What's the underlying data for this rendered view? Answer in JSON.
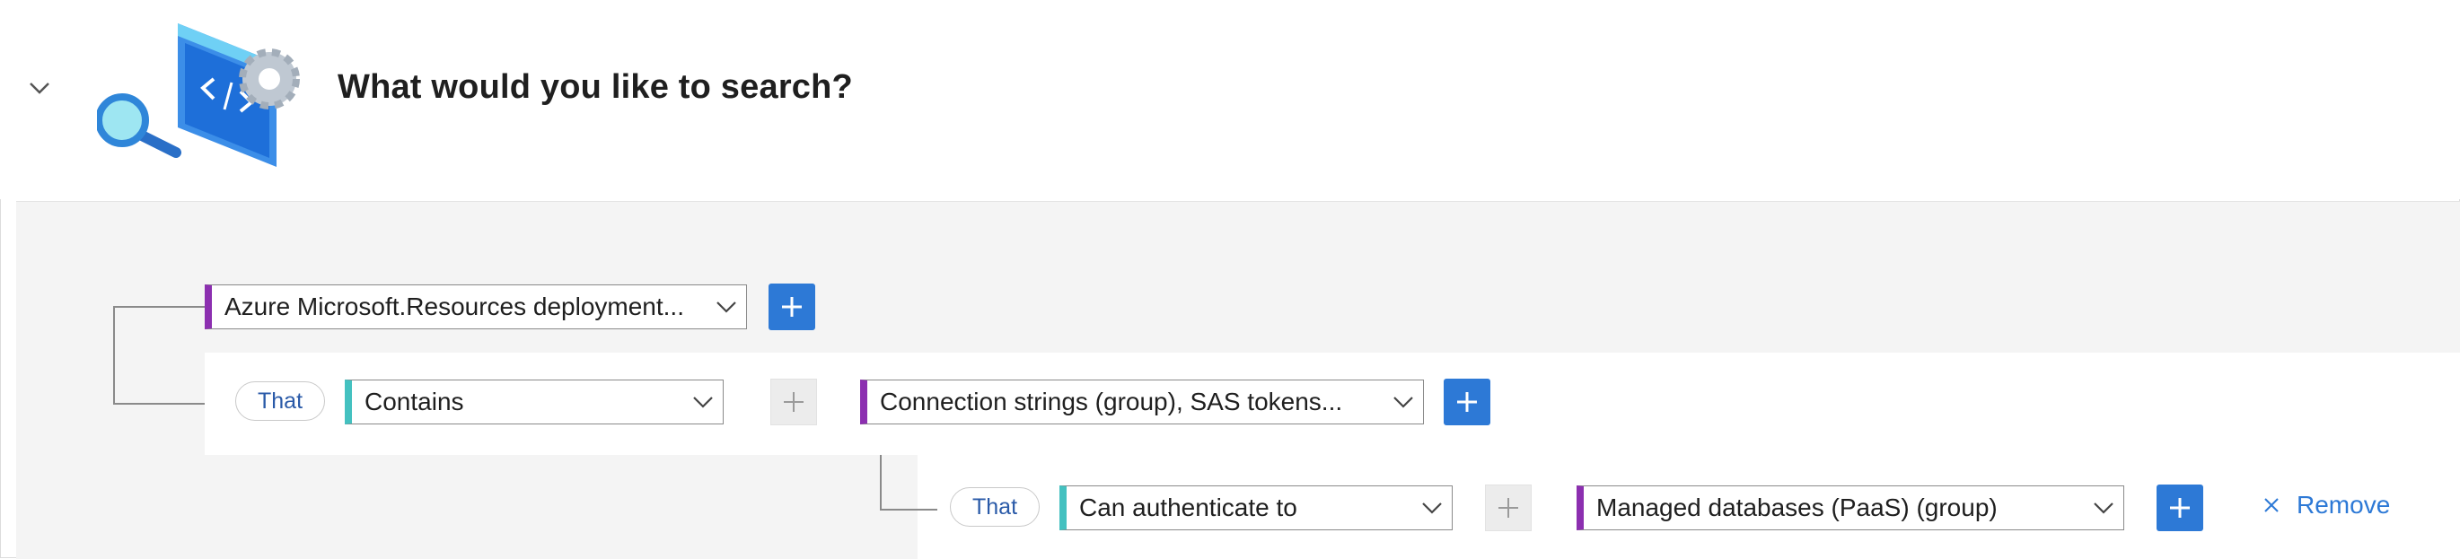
{
  "header": {
    "title": "What would you like to search?",
    "collapse_icon": "chevron-down-icon",
    "hero_icon": "code-settings-search-illustration"
  },
  "query": {
    "root": {
      "value": "Azure Microsoft.Resources deployment...",
      "add_icon": "plus-icon"
    },
    "level1": {
      "that_label": "That",
      "condition": "Contains",
      "target": "Connection strings (group), SAS tokens...",
      "add_icon": "plus-icon"
    },
    "level2": {
      "that_label": "That",
      "condition": "Can authenticate to",
      "target": "Managed databases (PaaS) (group)",
      "add_icon": "plus-icon",
      "remove_label": "Remove",
      "remove_icon": "close-icon"
    }
  },
  "colors": {
    "accent_blue": "#2d79d6",
    "purple_marker": "#8c2fb0",
    "teal_marker": "#44c1c0",
    "canvas_bg": "#f4f4f4"
  }
}
